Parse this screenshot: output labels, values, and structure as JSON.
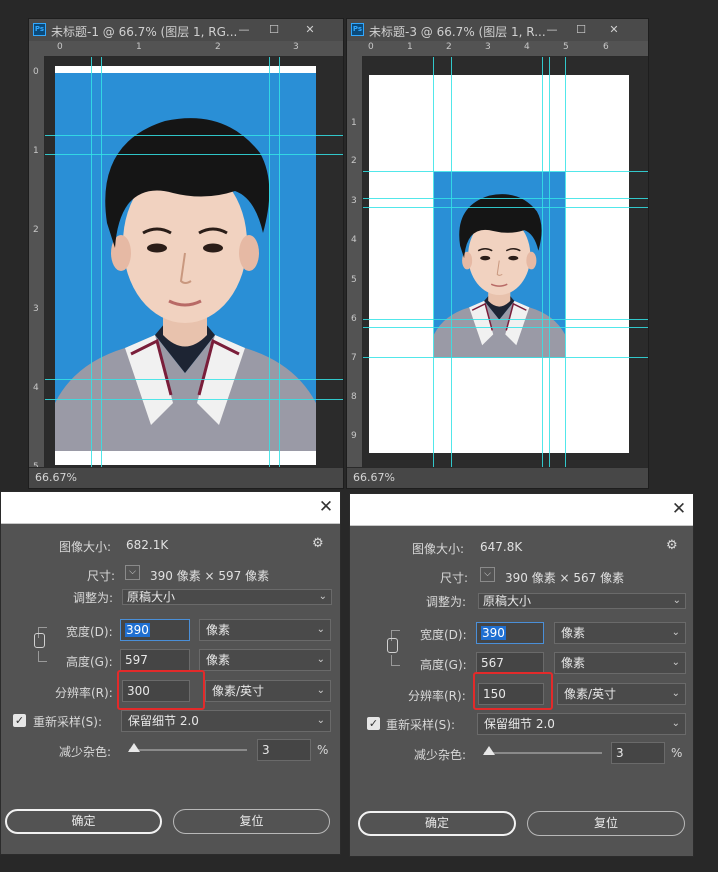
{
  "windows": [
    {
      "title": "未标题-1 @ 66.7% (图层 1, RG...",
      "ruler_h": [
        "0",
        "1",
        "2",
        "3"
      ],
      "ruler_v": [
        "0",
        "1",
        "2",
        "3",
        "4",
        "5"
      ],
      "zoom": "66.67%"
    },
    {
      "title": "未标题-3 @ 66.7% (图层 1, R...",
      "ruler_h": [
        "0",
        "1",
        "2",
        "3",
        "4",
        "5",
        "6"
      ],
      "ruler_v": [
        "1",
        "2",
        "3",
        "4",
        "5",
        "6",
        "7",
        "8",
        "9"
      ],
      "zoom": "66.67%"
    }
  ],
  "window_buttons": {
    "minimize": "—",
    "maximize": "☐",
    "close": "✕"
  },
  "dialogs": [
    {
      "image_size_label": "图像大小:",
      "image_size_value": "682.1K",
      "dimensions_label": "尺寸:",
      "dimensions_value": "390 像素 × 597 像素",
      "fit_to_label": "调整为:",
      "fit_to_value": "原稿大小",
      "width_label": "宽度(D):",
      "width_value": "390",
      "width_unit": "像素",
      "height_label": "高度(G):",
      "height_value": "597",
      "height_unit": "像素",
      "resolution_label": "分辨率(R):",
      "resolution_value": "300",
      "resolution_unit": "像素/英寸",
      "resample_label": "重新采样(S):",
      "resample_value": "保留细节 2.0",
      "noise_label": "减少杂色:",
      "noise_value": "3",
      "noise_unit": "%",
      "ok_label": "确定",
      "reset_label": "复位"
    },
    {
      "image_size_label": "图像大小:",
      "image_size_value": "647.8K",
      "dimensions_label": "尺寸:",
      "dimensions_value": "390 像素 × 567 像素",
      "fit_to_label": "调整为:",
      "fit_to_value": "原稿大小",
      "width_label": "宽度(D):",
      "width_value": "390",
      "width_unit": "像素",
      "height_label": "高度(G):",
      "height_value": "567",
      "height_unit": "像素",
      "resolution_label": "分辨率(R):",
      "resolution_value": "150",
      "resolution_unit": "像素/英寸",
      "resample_label": "重新采样(S):",
      "resample_value": "保留细节 2.0",
      "noise_label": "减少杂色:",
      "noise_value": "3",
      "noise_unit": "%",
      "ok_label": "确定",
      "reset_label": "复位"
    }
  ],
  "colors": {
    "guide": "#34e3e6",
    "photo_background": "#2a8fd6",
    "highlight_box": "#e32a2a"
  }
}
